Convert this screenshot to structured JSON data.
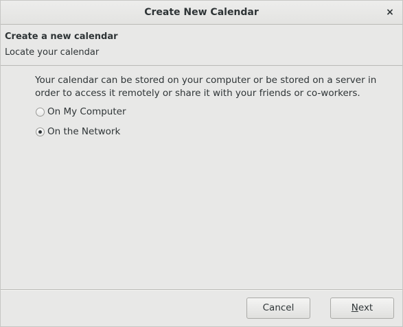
{
  "window": {
    "title": "Create New Calendar",
    "close_glyph": "×"
  },
  "header": {
    "title": "Create a new calendar",
    "subtitle": "Locate your calendar"
  },
  "content": {
    "description": "Your calendar can be stored on your computer or be stored on a server in order to access it remotely or share it with your friends or co-workers.",
    "options": [
      {
        "label": "On My Computer",
        "selected": false
      },
      {
        "label": "On the Network",
        "selected": true
      }
    ]
  },
  "buttons": {
    "cancel": "Cancel",
    "next": "Next"
  }
}
